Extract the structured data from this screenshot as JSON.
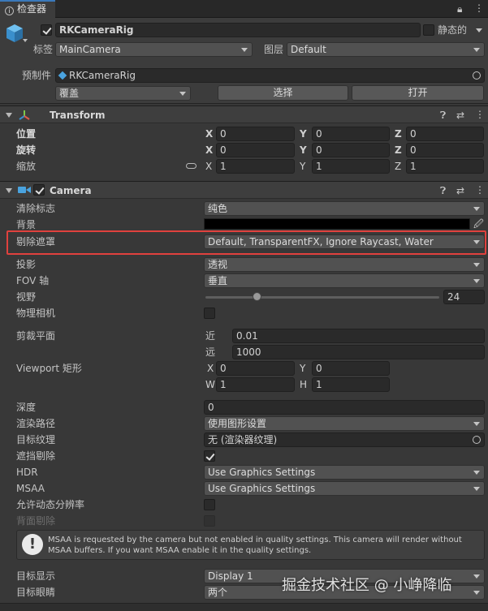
{
  "window": {
    "tab_title": "检查器"
  },
  "object": {
    "name": "RKCameraRig",
    "static_label": "静态的",
    "tag_label": "标签",
    "tag_value": "MainCamera",
    "layer_label": "图层",
    "layer_value": "Default"
  },
  "prefab": {
    "label": "预制件",
    "name": "RKCameraRig",
    "overrides": "覆盖",
    "select": "选择",
    "open": "打开"
  },
  "transform": {
    "title": "Transform",
    "position_label": "位置",
    "rotation_label": "旋转",
    "scale_label": "缩放",
    "position": {
      "x": "0",
      "y": "0",
      "z": "0"
    },
    "rotation": {
      "x": "0",
      "y": "0",
      "z": "0"
    },
    "scale": {
      "x": "1",
      "y": "1",
      "z": "1"
    },
    "axis_x": "X",
    "axis_y": "Y",
    "axis_z": "Z"
  },
  "camera": {
    "title": "Camera",
    "clear_flags_label": "清除标志",
    "clear_flags": "纯色",
    "background_label": "背景",
    "background_color": "#000000",
    "culling_mask_label": "剔除遮罩",
    "culling_mask": "Default, TransparentFX, Ignore Raycast, Water",
    "projection_label": "投影",
    "projection": "透视",
    "fov_axis_label": "FOV 轴",
    "fov_axis": "垂直",
    "fov_label": "视野",
    "fov_value": "24",
    "fov_fraction": 0.22,
    "physical_label": "物理相机",
    "clipping_label": "剪裁平面",
    "near_label": "近",
    "near": "0.01",
    "far_label": "远",
    "far": "1000",
    "viewport_label": "Viewport 矩形",
    "vp_x": "0",
    "vp_y": "0",
    "vp_w": "1",
    "vp_h": "1",
    "w_label": "W",
    "h_label": "H",
    "depth_label": "深度",
    "depth": "0",
    "render_path_label": "渲染路径",
    "render_path": "使用图形设置",
    "target_texture_label": "目标纹理",
    "target_texture": "无 (渲染器纹理)",
    "occlusion_label": "遮挡剔除",
    "hdr_label": "HDR",
    "hdr": "Use Graphics Settings",
    "msaa_label": "MSAA",
    "msaa": "Use Graphics Settings",
    "dynres_label": "允许动态分辨率",
    "backface_label": "背面剔除",
    "warning": "MSAA is requested by the camera but not enabled in quality settings. This camera will render without MSAA buffers. If you want MSAA enable it in the quality settings.",
    "target_display_label": "目标显示",
    "target_display": "Display 1",
    "target_eye_label": "目标眼睛",
    "target_eye": "两个"
  },
  "watermark": "掘金技术社区 @ 小峥降临",
  "colors": {
    "highlight": "#e0413e",
    "accent": "#3a79bb",
    "cube": "#4aa3df"
  }
}
